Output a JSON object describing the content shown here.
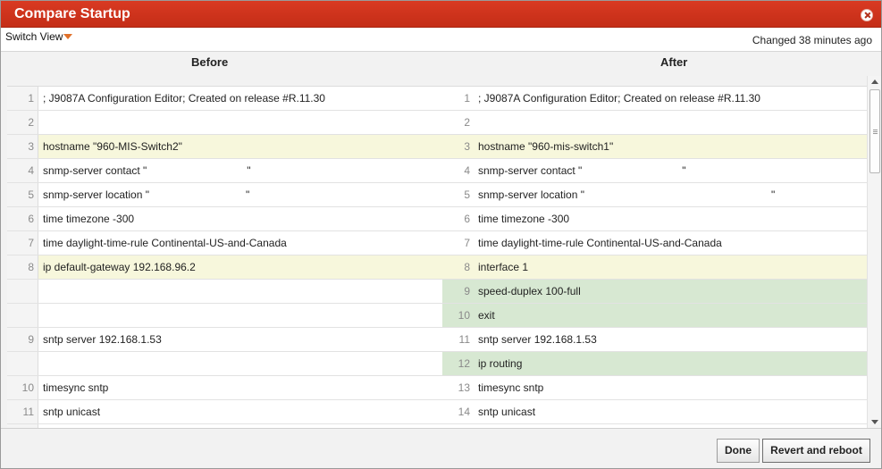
{
  "dialog": {
    "title": "Compare Startup",
    "switch_view_label": "Switch View",
    "changed_text": "Changed 38 minutes ago",
    "before_header": "Before",
    "after_header": "After"
  },
  "rows": [
    {
      "left_num": "1",
      "left_text": "; J9087A Configuration Editor; Created on release #R.11.30",
      "right_num": "1",
      "right_text": "; J9087A Configuration Editor; Created on release #R.11.30",
      "status": "same"
    },
    {
      "left_num": "2",
      "left_text": "",
      "right_num": "2",
      "right_text": "",
      "status": "same"
    },
    {
      "left_num": "3",
      "left_text": "hostname \"960-MIS-Switch2\"",
      "right_num": "3",
      "right_text": "hostname \"960-mis-switch1\"",
      "status": "modified"
    },
    {
      "left_num": "4",
      "left_text": "snmp-server contact \"",
      "left_suffix": "\"",
      "right_num": "4",
      "right_text": "snmp-server contact \"",
      "right_suffix": "\"",
      "status": "same",
      "redacted": true
    },
    {
      "left_num": "5",
      "left_text": "snmp-server location \"",
      "left_suffix": "\"",
      "right_num": "5",
      "right_text": "snmp-server location \"",
      "right_suffix": "\"",
      "status": "same",
      "redacted": true
    },
    {
      "left_num": "6",
      "left_text": "time timezone -300",
      "right_num": "6",
      "right_text": "time timezone -300",
      "status": "same"
    },
    {
      "left_num": "7",
      "left_text": "time daylight-time-rule Continental-US-and-Canada",
      "right_num": "7",
      "right_text": "time daylight-time-rule Continental-US-and-Canada",
      "status": "same"
    },
    {
      "left_num": "8",
      "left_text": "ip default-gateway 192.168.96.2",
      "right_num": "8",
      "right_text": "interface 1",
      "status": "modified"
    },
    {
      "left_num": "",
      "left_text": "",
      "right_num": "9",
      "right_text": "speed-duplex 100-full",
      "status": "added"
    },
    {
      "left_num": "",
      "left_text": "",
      "right_num": "10",
      "right_text": "exit",
      "status": "added"
    },
    {
      "left_num": "9",
      "left_text": "sntp server 192.168.1.53",
      "right_num": "11",
      "right_text": "sntp server 192.168.1.53",
      "status": "same"
    },
    {
      "left_num": "",
      "left_text": "",
      "right_num": "12",
      "right_text": "ip routing",
      "status": "added"
    },
    {
      "left_num": "10",
      "left_text": "timesync sntp",
      "right_num": "13",
      "right_text": "timesync sntp",
      "status": "same"
    },
    {
      "left_num": "11",
      "left_text": "sntp unicast",
      "right_num": "14",
      "right_text": "sntp unicast",
      "status": "same"
    },
    {
      "left_num": "",
      "left_text": "",
      "right_num": "",
      "right_text": "",
      "status": "same"
    }
  ],
  "buttons": {
    "done": "Done",
    "revert": "Revert and reboot"
  },
  "icons": {
    "close": "close-icon",
    "switch_view_caret": "caret-down-icon",
    "scroll_up": "arrow-up-icon",
    "scroll_down": "arrow-down-icon"
  },
  "colors": {
    "titlebar": "#c42d17",
    "modified": "#f7f7dc",
    "added": "#d7e8d2",
    "caret": "#e0702a"
  }
}
